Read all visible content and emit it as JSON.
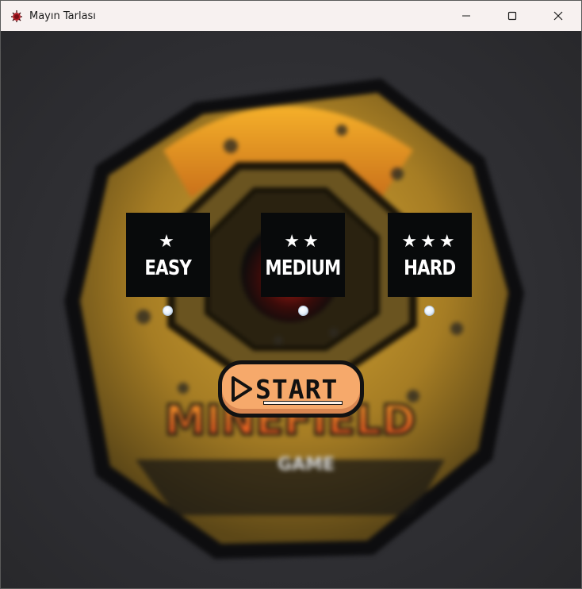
{
  "window": {
    "title": "Mayın Tarlası",
    "app_icon": "mine-bug-icon",
    "controls": [
      "minimize-icon",
      "maximize-icon",
      "close-icon"
    ]
  },
  "difficulty": {
    "options": [
      {
        "label": "EASY",
        "stars": "★",
        "star_count": 1
      },
      {
        "label": "MEDIUM",
        "stars": "★★",
        "star_count": 2
      },
      {
        "label": "HARD",
        "stars": "★★★",
        "star_count": 3
      }
    ]
  },
  "start_button": {
    "label": "START"
  },
  "logo": {
    "title": "MINEFIELD",
    "subtitle": "GAME"
  },
  "colors": {
    "card_bg": "#080a0b",
    "start_bg": "#f6a96b",
    "logo_gold": "#c9a02a",
    "logo_orange": "#f08a1c"
  }
}
